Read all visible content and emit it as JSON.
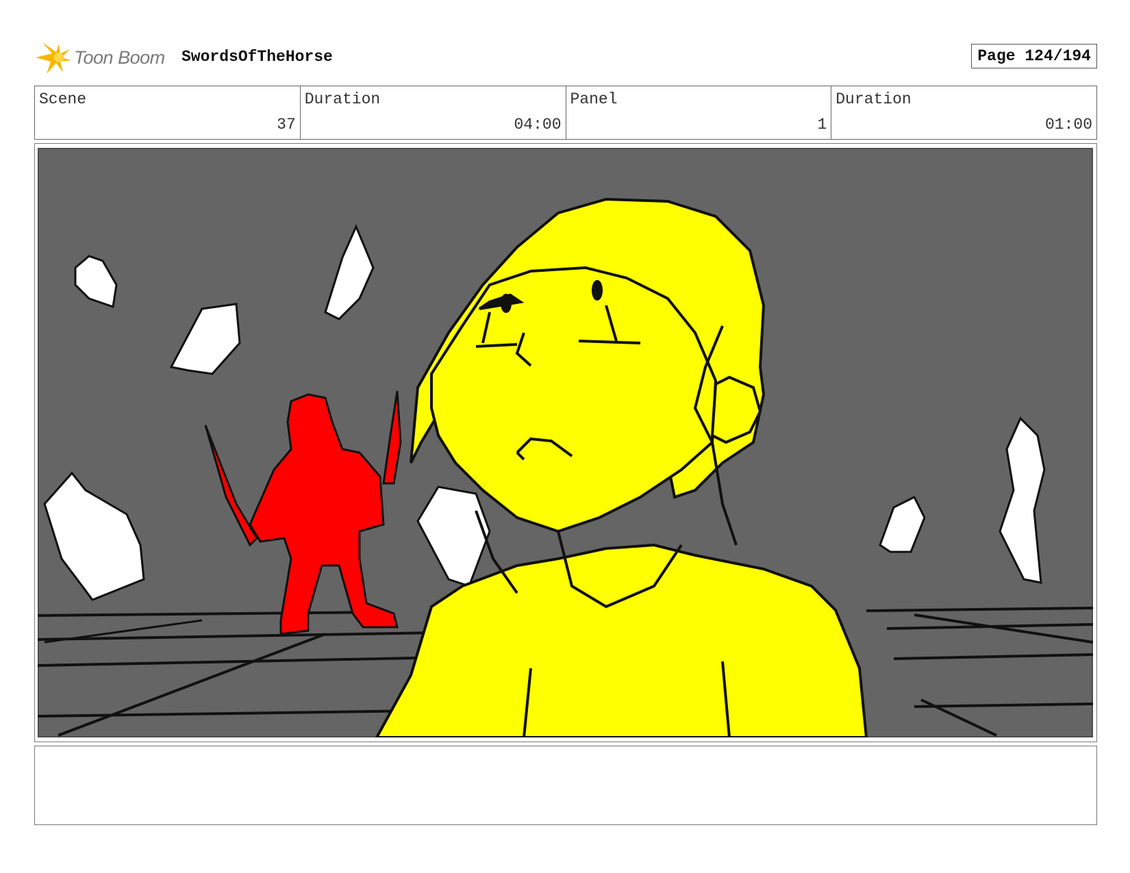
{
  "header": {
    "logo_text": "Toon Boom",
    "logo_icon": "starburst-logo-icon",
    "project_title": "SwordsOfTheHorse",
    "page_label": "Page 124/194"
  },
  "info": {
    "scene_label": "Scene",
    "scene_value": "37",
    "scene_duration_label": "Duration",
    "scene_duration_value": "04:00",
    "panel_label": "Panel",
    "panel_value": "1",
    "panel_duration_label": "Duration",
    "panel_duration_value": "01:00"
  },
  "colors": {
    "background": "#656565",
    "character_main": "#ffff00",
    "character_enemy": "#ff0000",
    "rocks": "#ffffff",
    "logo_accent": "#f5b800"
  },
  "notes": {
    "text": ""
  }
}
